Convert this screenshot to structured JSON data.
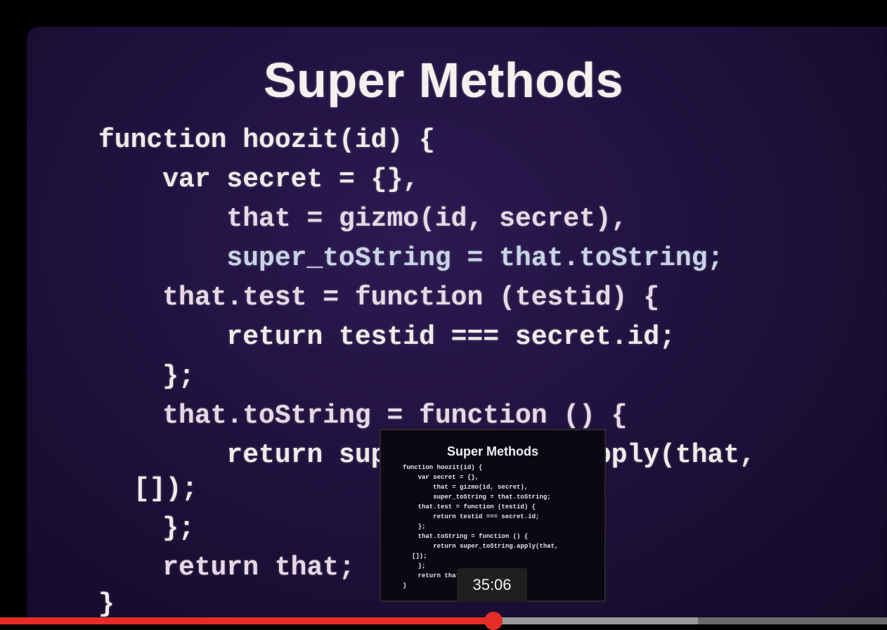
{
  "player": {
    "progress_fraction": 0.556,
    "buffered_fraction": 0.787,
    "hover_time": "35:06",
    "colors": {
      "played": "#e52d27",
      "buffered": "#9b9b9b",
      "track": "#6b6b6b"
    }
  },
  "slide": {
    "title": "Super Methods",
    "code_lines": [
      "function hoozit(id) {",
      "    var secret = {},",
      "        that = gizmo(id, secret),",
      "        super_toString = that.toString;",
      "    that.test = function (testid) {",
      "        return testid === secret.id;",
      "    };",
      "    that.toString = function () {",
      "        return super_toString.apply(that,",
      "[]);",
      "    };",
      "    return that;",
      "}"
    ]
  },
  "preview": {
    "title": "Super Methods",
    "code_lines": [
      "function hoozit(id) {",
      "    var secret = {},",
      "        that = gizmo(id, secret),",
      "        super_toString = that.toString;",
      "    that.test = function (testid) {",
      "        return testid === secret.id;",
      "    };",
      "    that.toString = function () {",
      "        return super_toString.apply(that,",
      "[]);",
      "    };",
      "    return that;",
      "}"
    ]
  }
}
